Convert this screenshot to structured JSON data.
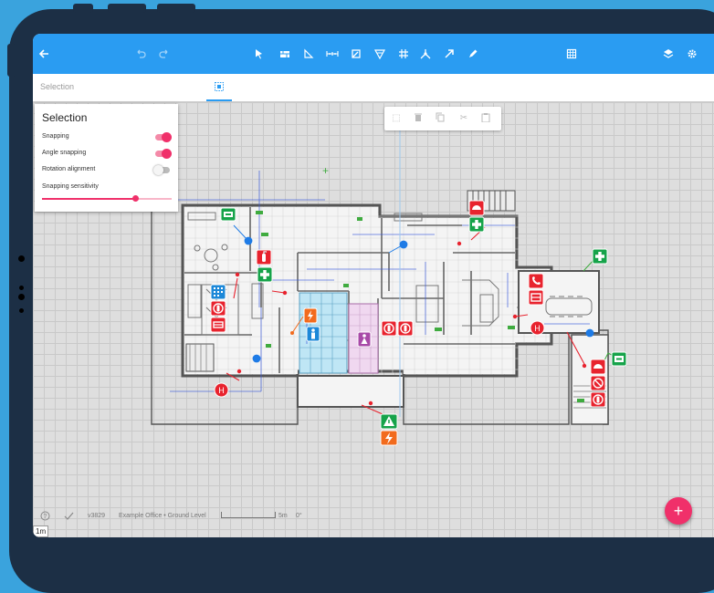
{
  "subbar": {
    "mode_label": "Selection"
  },
  "panel": {
    "title": "Selection",
    "rows": [
      {
        "label": "Snapping",
        "on": true
      },
      {
        "label": "Angle snapping",
        "on": true
      },
      {
        "label": "Rotation alignment",
        "on": false
      }
    ],
    "sensitivity_label": "Snapping sensitivity",
    "sensitivity_value": 0.72
  },
  "status": {
    "version": "v3829",
    "document": "Example Office • Ground Level",
    "scale": "5m",
    "angle": "0°"
  },
  "scale_badge": "1m",
  "fab_label": "+",
  "colors": {
    "accent": "#2a9cf2",
    "pink": "#f0306a",
    "fire": "#e8232e",
    "escape": "#16a34a",
    "electric": "#f26b1d"
  },
  "icons": {
    "appbar": [
      "back-arrow-icon",
      "undo-icon",
      "redo-icon",
      "pointer-icon",
      "wall-icon",
      "room-icon",
      "dimension-icon",
      "door-icon",
      "window-icon",
      "stairs-icon",
      "node-icon",
      "arrow-icon",
      "pencil-icon",
      "grid-icon",
      "layers-icon",
      "gear-icon"
    ],
    "editbar": [
      "crop-icon",
      "trash-icon",
      "copy-icon",
      "scissors-icon",
      "paste-icon"
    ]
  }
}
